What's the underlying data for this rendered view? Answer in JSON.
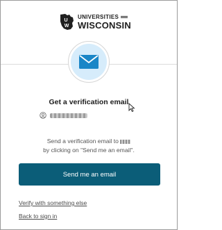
{
  "brand": {
    "top": "UNIVERSITIES",
    "bottom": "WISCONSIN",
    "color": "#202020"
  },
  "factor": {
    "icon": "envelope-icon",
    "circle_color": "#d6ecfb",
    "icon_color": "#1a86c7"
  },
  "title": "Get a verification email",
  "user": {
    "icon": "person-circle-icon"
  },
  "description": {
    "line1": "Send a verification email to",
    "line2": "by clicking on \"Send me an email\"."
  },
  "primary_button": {
    "label": "Send me an email",
    "color": "#0b5d78"
  },
  "links": {
    "verify_other": "Verify with something else",
    "back": "Back to sign in"
  }
}
